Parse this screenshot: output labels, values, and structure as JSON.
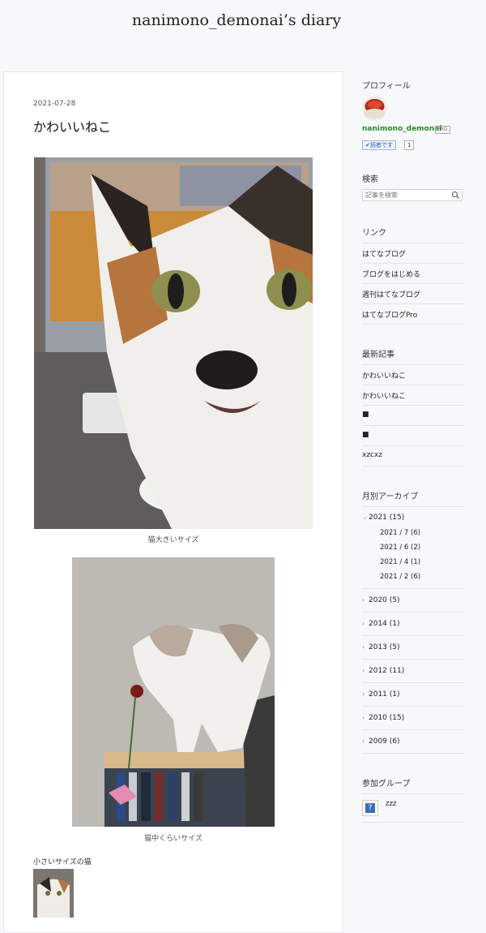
{
  "header": {
    "blog_title": "nanimono_demonai’s diary"
  },
  "entry": {
    "date": "2021-07-28",
    "title": "かわいいねこ",
    "caption_large": "猫大きいサイズ",
    "caption_medium": "猫中くらいサイズ",
    "small_label": "小さいサイズの猫"
  },
  "sidebar": {
    "profile": {
      "heading": "プロフィール",
      "username": "nanimono_demonai",
      "pro_badge": "PRO",
      "reader_button": "✔読者です",
      "reader_count": "1"
    },
    "search": {
      "heading": "検索",
      "placeholder": "記事を検索"
    },
    "links": {
      "heading": "リンク",
      "items": [
        "はてなブログ",
        "ブログをはじめる",
        "週刊はてなブログ",
        "はてなブログPro"
      ]
    },
    "recent": {
      "heading": "最新記事",
      "items": [
        "かわいいねこ",
        "かわいいねこ",
        "■",
        "■",
        "xzcxz"
      ]
    },
    "archive": {
      "heading": "月別アーカイブ",
      "open_year": "2021 (15)",
      "months": [
        "2021 / 7 (6)",
        "2021 / 6 (2)",
        "2021 / 4 (1)",
        "2021 / 2 (6)"
      ],
      "years": [
        "2020 (5)",
        "2014 (1)",
        "2013 (5)",
        "2012 (11)",
        "2011 (1)",
        "2010 (15)",
        "2009 (6)"
      ]
    },
    "groups": {
      "heading": "参加グループ",
      "name": "zzz"
    }
  }
}
